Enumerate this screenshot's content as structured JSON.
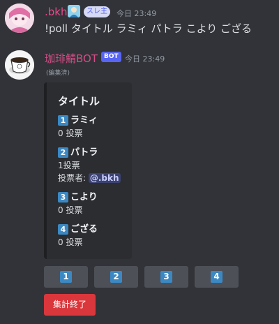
{
  "message1": {
    "username": ".bkh",
    "role_tag": "スレ主",
    "timestamp": "今日 23:49",
    "content": "!poll タイトル ラミィ パトラ こより ござる"
  },
  "message2": {
    "username": "珈琲鯖BOT",
    "bot_tag": "BOT",
    "timestamp": "今日 23:49",
    "edited": "(編集済)",
    "embed": {
      "title": "タイトル",
      "fields": [
        {
          "key": "1",
          "name": "ラミィ",
          "votes": "0 投票"
        },
        {
          "key": "2",
          "name": "パトラ",
          "votes": "1投票",
          "voters_label": "投票者:",
          "voter": "@.bkh"
        },
        {
          "key": "3",
          "name": "こより",
          "votes": "0 投票"
        },
        {
          "key": "4",
          "name": "ござる",
          "votes": "0 投票"
        }
      ]
    },
    "buttons": [
      "1",
      "2",
      "3",
      "4"
    ],
    "end_button": "集計終了"
  },
  "colors": {
    "background": "#313338",
    "keycap": "#3b88c3",
    "danger": "#da373c",
    "bot_badge": "#5865f2"
  }
}
